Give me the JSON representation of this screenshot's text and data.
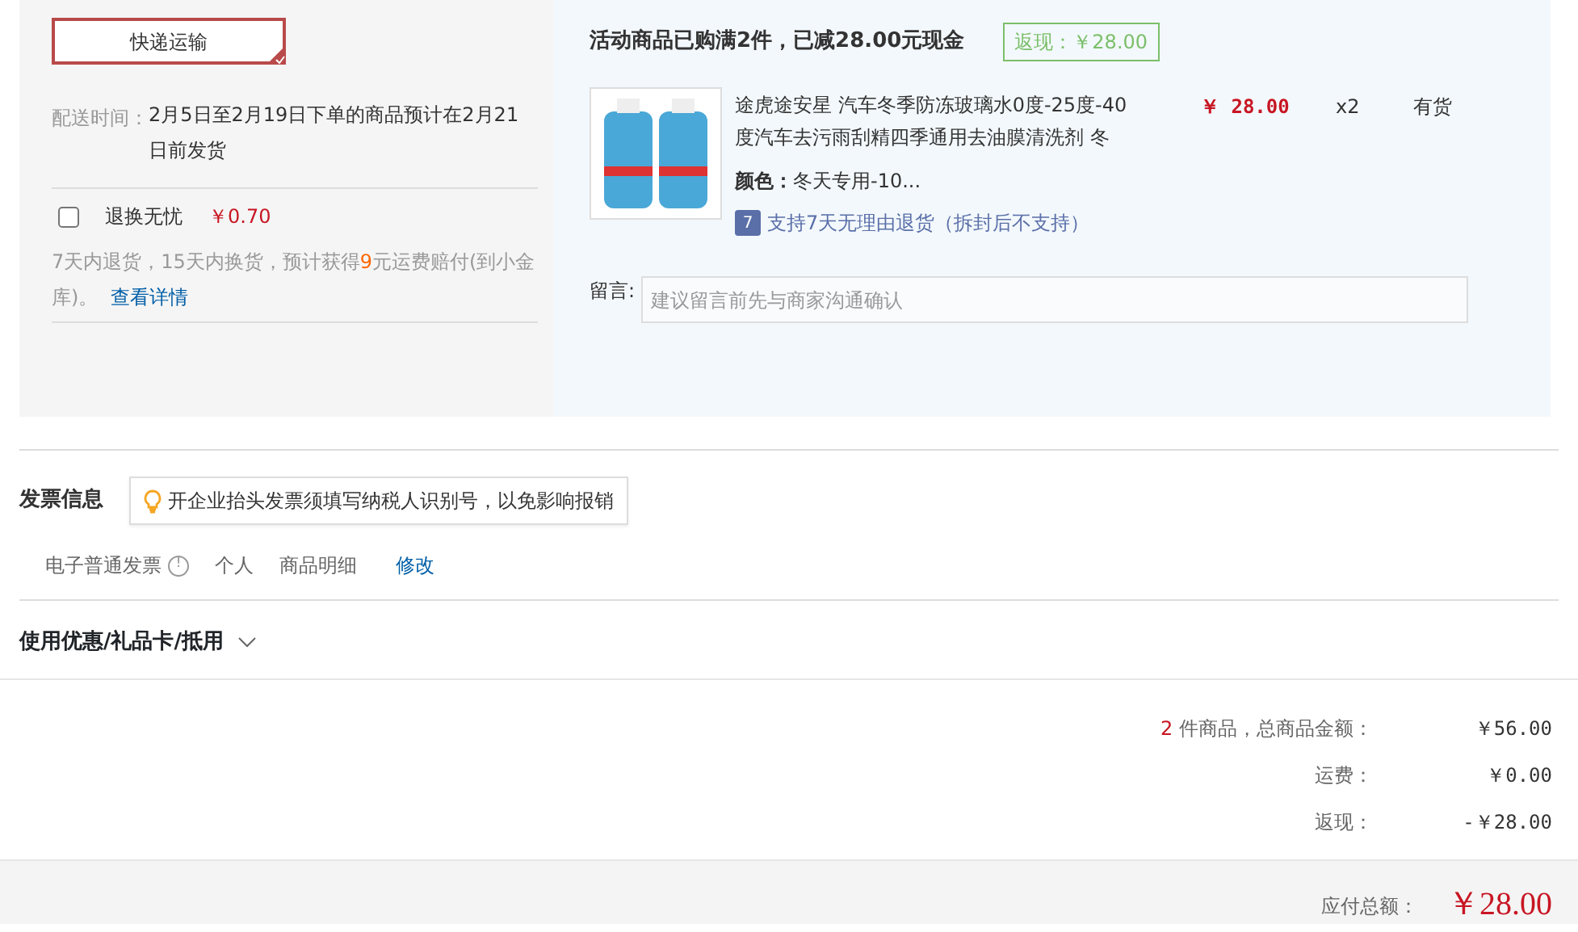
{
  "shipping": {
    "method": {
      "label": "快递运输",
      "selected": true
    },
    "time_label": "配送时间：",
    "time_text": "2月5日至2月19日下单的商品预计在2月21日前发货",
    "insurance": {
      "label": "退换无忧",
      "price": "￥0.70",
      "checked": false
    },
    "note_before": "7天内退货，15天内换货，预计获得",
    "note_highlight": "9",
    "note_after": "元运费赔付(到小金库)。",
    "details_link": "查看详情"
  },
  "promotion": {
    "text": "活动商品已购满2件，已减28.00元现金",
    "badge": "返现：￥28.00"
  },
  "product": {
    "title": "途虎途安星 汽车冬季防冻玻璃水0度-25度-40度汽车去污雨刮精四季通用去油膜清洗剂 冬",
    "price": "￥ 28.00",
    "quantity": "x2",
    "stock": "有货",
    "color_label": "颜色：",
    "color_value": "冬天专用-10...",
    "return_icon": "7",
    "return_policy": "支持7天无理由退货（拆封后不支持）"
  },
  "message": {
    "label": "留言:",
    "placeholder": "建议留言前先与商家沟通确认"
  },
  "invoice": {
    "title": "发票信息",
    "tip": "开企业抬头发票须填写纳税人识别号，以免影响报销",
    "type": "电子普通发票",
    "info_icon": "!",
    "holder": "个人",
    "content": "商品明细",
    "edit_link": "修改"
  },
  "coupons": {
    "title": "使用优惠/礼品卡/抵用",
    "expanded": false
  },
  "summary": [
    {
      "count": "2",
      "label": " 件商品，总商品金额：",
      "value": "￥56.00"
    },
    {
      "label": "运费：",
      "value": "￥0.00"
    },
    {
      "label": "返现：",
      "value": "-￥28.00"
    }
  ],
  "total": {
    "label": "应付总额：",
    "value": "￥28.00"
  }
}
